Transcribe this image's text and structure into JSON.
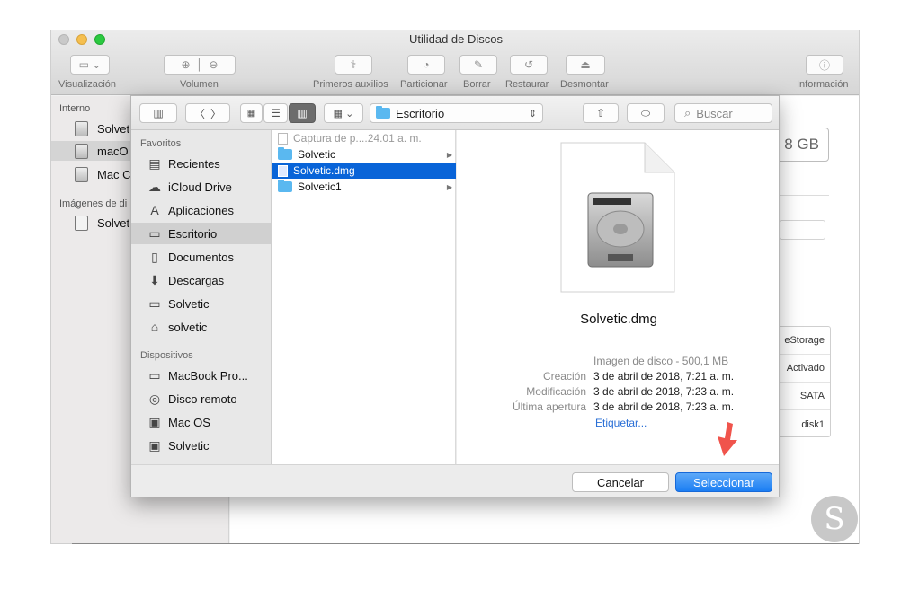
{
  "disk_utility": {
    "title": "Utilidad de Discos",
    "toolbar": {
      "view_label": "Visualización",
      "volume_label": "Volumen",
      "first_aid_label": "Primeros auxilios",
      "partition_label": "Particionar",
      "erase_label": "Borrar",
      "restore_label": "Restaurar",
      "unmount_label": "Desmontar",
      "info_label": "Información"
    },
    "sidebar": {
      "internal_header": "Interno",
      "items": [
        "Solvet",
        "macO",
        "Mac C"
      ],
      "images_header": "Imágenes de di",
      "image_items": [
        "Solvet"
      ]
    },
    "capacity": "8 GB",
    "info_values": [
      "eStorage",
      "Activado",
      "SATA",
      "disk1"
    ]
  },
  "dialog": {
    "location": "Escritorio",
    "search_placeholder": "Buscar",
    "sidebar": {
      "favorites_header": "Favoritos",
      "favorites": [
        {
          "label": "Recientes",
          "icon": "recents-icon"
        },
        {
          "label": "iCloud Drive",
          "icon": "cloud-icon"
        },
        {
          "label": "Aplicaciones",
          "icon": "applications-icon"
        },
        {
          "label": "Escritorio",
          "icon": "desktop-icon",
          "selected": true
        },
        {
          "label": "Documentos",
          "icon": "documents-icon"
        },
        {
          "label": "Descargas",
          "icon": "downloads-icon"
        },
        {
          "label": "Solvetic",
          "icon": "folder-icon"
        },
        {
          "label": "solvetic",
          "icon": "home-icon"
        }
      ],
      "devices_header": "Dispositivos",
      "devices": [
        {
          "label": "MacBook Pro...",
          "icon": "laptop-icon"
        },
        {
          "label": "Disco remoto",
          "icon": "disc-icon"
        },
        {
          "label": "Mac OS",
          "icon": "disk-icon"
        },
        {
          "label": "Solvetic",
          "icon": "disk-icon"
        }
      ]
    },
    "files": [
      {
        "name": "Captura de p....24.01 a. m.",
        "type": "image",
        "dimmed": true
      },
      {
        "name": "Solvetic",
        "type": "folder",
        "has_children": true
      },
      {
        "name": "Solvetic.dmg",
        "type": "dmg",
        "selected": true
      },
      {
        "name": "Solvetic1",
        "type": "folder",
        "has_children": true
      }
    ],
    "preview": {
      "filename": "Solvetic.dmg",
      "kind": "Imagen de disco - 500,1 MB",
      "created_key": "Creación",
      "created_val": "3 de abril de 2018, 7:21 a. m.",
      "modified_key": "Modificación",
      "modified_val": "3 de abril de 2018, 7:23 a. m.",
      "opened_key": "Última apertura",
      "opened_val": "3 de abril de 2018, 7:23 a. m.",
      "tags_link": "Etiquetar..."
    },
    "buttons": {
      "cancel": "Cancelar",
      "select": "Seleccionar"
    }
  },
  "colors": {
    "selection": "#0964d8",
    "primary_button": "#1b7ef3",
    "annotation_arrow": "#f0544c"
  }
}
